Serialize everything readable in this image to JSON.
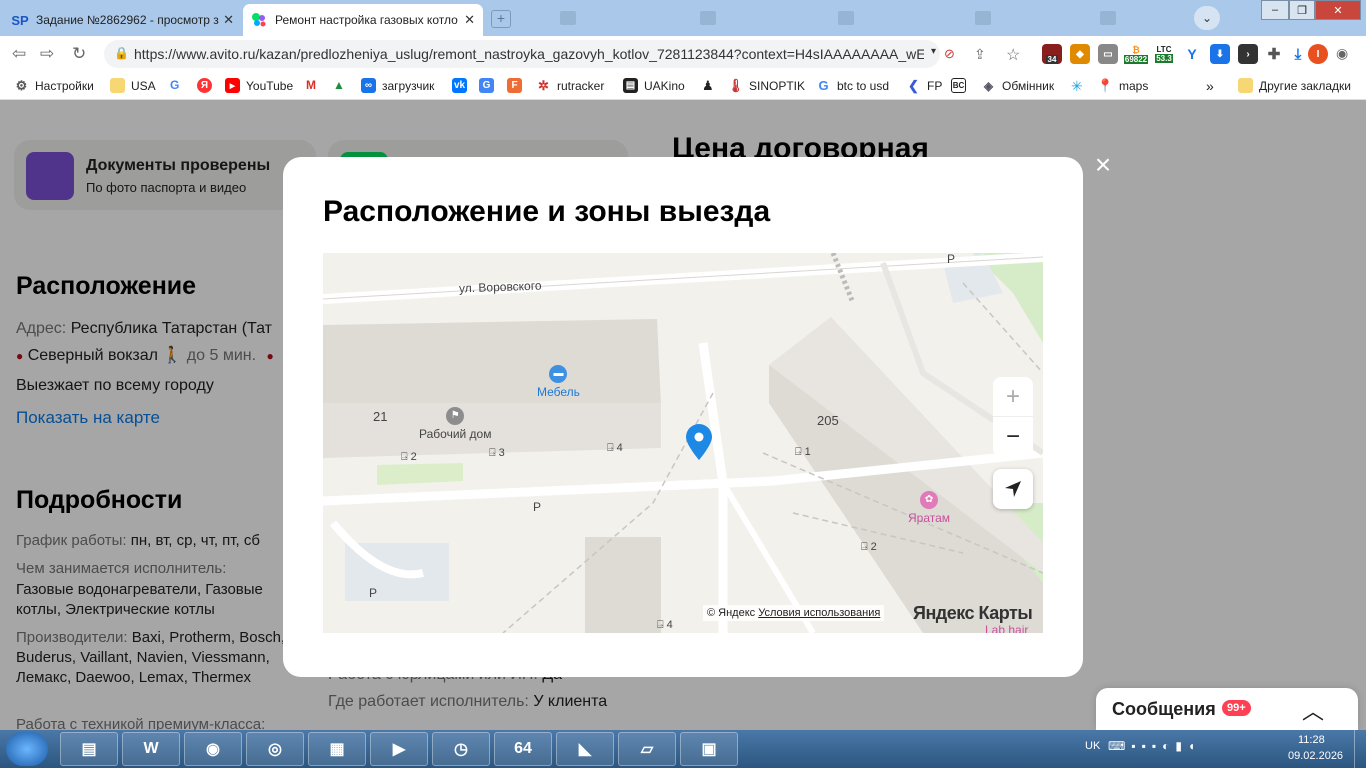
{
  "browser": {
    "tabs": [
      {
        "favicon": "SP",
        "title": "Задание №2862962 - просмотр з"
      },
      {
        "favicon": "avito-icon",
        "title": "Ремонт настройка газовых котло"
      }
    ],
    "url": "https://www.avito.ru/kazan/predlozheniya_uslug/remont_nastroyka_gazovyh_kotlov_7281123844?context=H4sIAAAAAAAA_wE...",
    "extensions": {
      "badge_34": "34",
      "ltc_label": "LTC",
      "ltc_value": "53.3",
      "btc_value": "69822",
      "profile": "I"
    },
    "bookmarks": [
      "Настройки",
      "USA",
      "YouTube",
      "загрузчик",
      "rutracker",
      "UAKino",
      "SINOPTIK",
      "btc to usd",
      "FP",
      "Обмінник",
      "maps"
    ],
    "other_bookmarks": "Другие закладки"
  },
  "page": {
    "badge_title": "Документы проверены",
    "badge_sub": "По фото паспорта и видео",
    "price": "Цена договорная",
    "location_heading": "Расположение",
    "address_label": "Адрес:",
    "address_value": "Республика Татарстан (Тат",
    "station": "Северный вокзал",
    "walk": "до 5 мин.",
    "travels": "Выезжает по всему городу",
    "show_map": "Показать на карте",
    "details_heading": "Подробности",
    "schedule_label": "График работы:",
    "schedule_value": "пн, вт, ср, чт, пт, сб",
    "does_label": "Чем занимается исполнитель:",
    "does_value": "Газовые водонагреватели, Газовые котлы, Электрические котлы",
    "makers_label": "Производители:",
    "makers_value": "Baxi, Protherm, Bosch, Buderus, Vaillant, Navien, Viessmann, Лемакс, Daewoo, Lemax, Thermex",
    "premium_label": "Работа с техникой премиум-класса:",
    "legal_label": "Работа с юрлицами или ИП:",
    "legal_value": "Да",
    "where_label": "Где работает исполнитель:",
    "where_value": "У клиента"
  },
  "modal": {
    "title": "Расположение и зоны выезда",
    "map": {
      "street": "ул. Воровского",
      "poi_furniture": "Мебель",
      "poi_workhouse": "Рабочий дом",
      "poi_yaratam": "Яратам",
      "poi_labhair": "Lab hair",
      "house_21": "21",
      "house_205": "205",
      "entrances": [
        "2",
        "3",
        "4",
        "1",
        "2",
        "4"
      ],
      "parking": "P",
      "copyright": "© Яндекс",
      "terms": "Условия использования",
      "brand": "Яндекс Карты",
      "zoom_in": "+",
      "zoom_out": "−"
    }
  },
  "messages": {
    "label": "Сообщения",
    "count": "99+"
  },
  "taskbar": {
    "lang": "UK",
    "time": "11:28",
    "date": "09.02.2026"
  }
}
